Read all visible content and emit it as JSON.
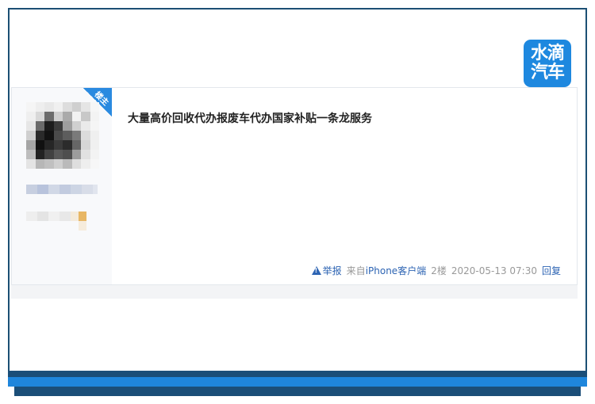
{
  "logo": {
    "line1": "水滴",
    "line2": "汽车",
    "bg_color": "#1e88df"
  },
  "post": {
    "badge": "楼主",
    "title": "大量高价回收代办报废车代办国家补贴一条龙服务",
    "meta": {
      "report_label": "举报",
      "from_prefix": "来自",
      "client": "iPhone客户端",
      "floor": "2楼",
      "timestamp": "2020-05-13 07:30",
      "reply_label": "回复"
    }
  },
  "colors": {
    "frame": "#1c4f74",
    "accent": "#1f86dc",
    "link": "#2d64b3"
  }
}
